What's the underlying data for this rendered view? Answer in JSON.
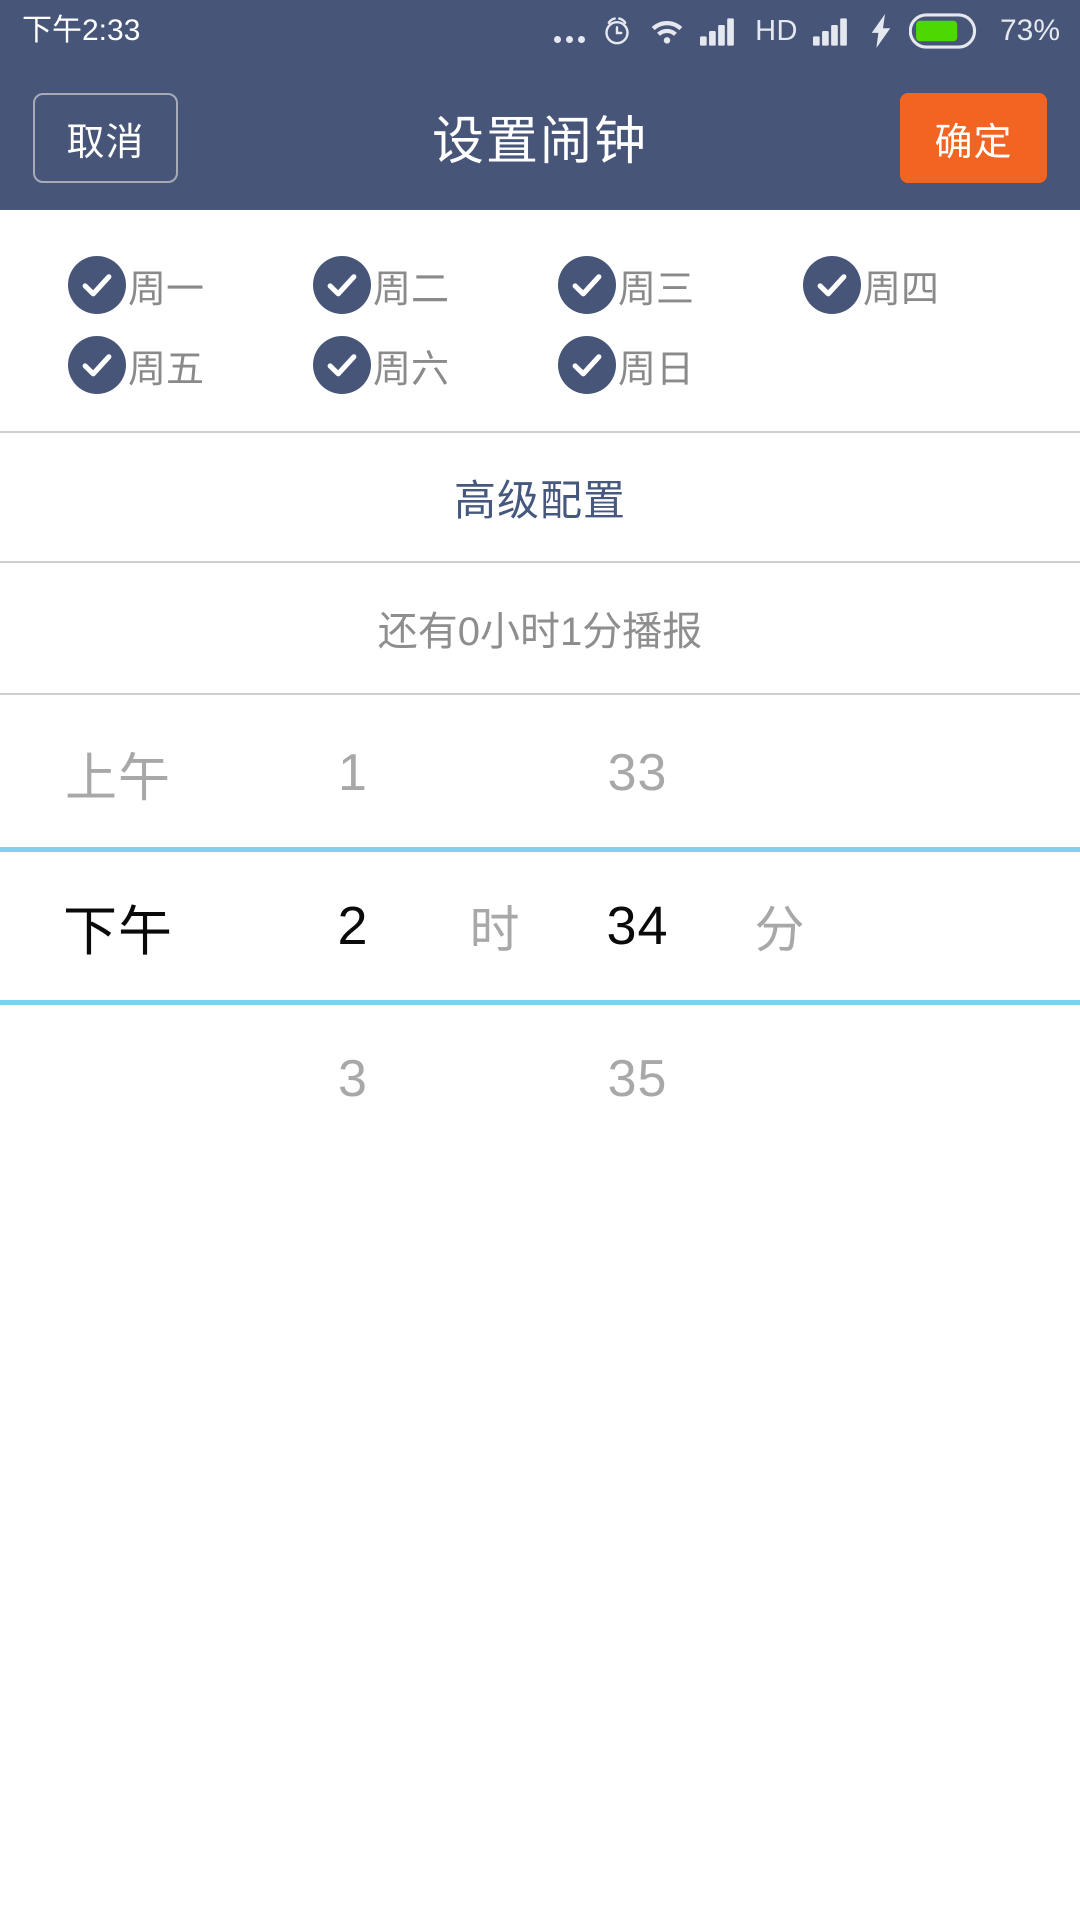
{
  "status_bar": {
    "time": "下午2:33",
    "icons": [
      "more-dots-icon",
      "alarm-icon",
      "wifi-icon",
      "signal-icon",
      "hd-icon",
      "signal-icon-2",
      "charging-bolt-icon",
      "battery-icon"
    ],
    "hd_label": "HD",
    "battery_percent": "73%",
    "battery_color": "#4cd800",
    "background": "#475578"
  },
  "header": {
    "cancel_label": "取消",
    "title": "设置闹钟",
    "confirm_label": "确定",
    "background": "#475578",
    "confirm_color": "#f26422"
  },
  "weekdays": {
    "rows": [
      [
        {
          "label": "周一",
          "checked": true
        },
        {
          "label": "周二",
          "checked": true
        },
        {
          "label": "周三",
          "checked": true
        },
        {
          "label": "周四",
          "checked": true
        }
      ],
      [
        {
          "label": "周五",
          "checked": true
        },
        {
          "label": "周六",
          "checked": true
        },
        {
          "label": "周日",
          "checked": true
        }
      ]
    ],
    "check_color": "#475578"
  },
  "advanced_config": {
    "label": "高级配置",
    "color": "#46587e"
  },
  "countdown": {
    "label": "还有0小时1分播报",
    "color": "#8e8e8e"
  },
  "time_picker": {
    "highlight_color": "#7fd0ee",
    "rows": {
      "above": {
        "ampm": "上午",
        "hour": "1",
        "hour_unit": "",
        "minute": "33",
        "minute_unit": ""
      },
      "selected": {
        "ampm": "下午",
        "hour": "2",
        "hour_unit": "时",
        "minute": "34",
        "minute_unit": "分"
      },
      "below": {
        "ampm": "",
        "hour": "3",
        "hour_unit": "",
        "minute": "35",
        "minute_unit": ""
      }
    }
  }
}
